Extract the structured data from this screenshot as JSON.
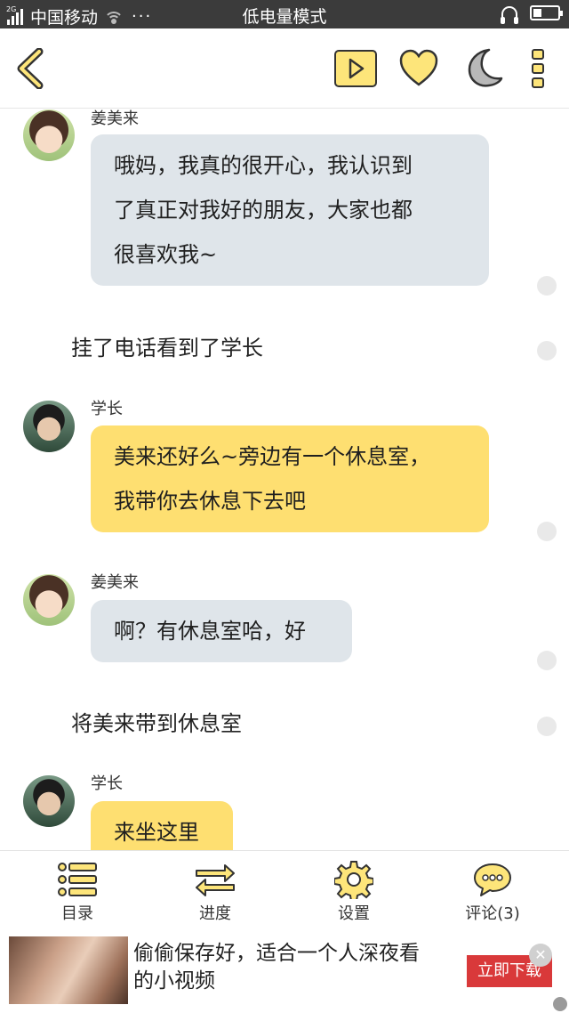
{
  "status_bar": {
    "network_tag": "2G",
    "carrier": "中国移动",
    "more_indicator": "···",
    "mode": "低电量模式",
    "battery_level": 0.35
  },
  "toolbar": {
    "icons": [
      "back-icon",
      "play-icon",
      "heart-icon",
      "moon-icon",
      "more-vertical-icon"
    ],
    "accent": "#fde57a"
  },
  "chat": {
    "messages": [
      {
        "speaker": "姜美来",
        "text_lines": [
          "哦妈，我真的很开心，我认识到",
          "了真正对我好的朋友，大家也都",
          "很喜欢我~"
        ]
      },
      {
        "narration": "挂了电话看到了学长"
      },
      {
        "speaker": "学长",
        "text_lines": [
          "美来还好么~旁边有一个休息室，",
          "我带你去休息下去吧"
        ]
      },
      {
        "speaker": "姜美来",
        "text_lines": [
          "啊？有休息室哈，好"
        ]
      },
      {
        "narration": "将美来带到休息室"
      },
      {
        "speaker": "学长",
        "text_lines": [
          "来坐这里"
        ]
      }
    ],
    "colors": {
      "other_bubble": "#dfe5ea",
      "senior_bubble": "#fedf71"
    }
  },
  "bottom_nav": {
    "items": [
      {
        "label": "目录",
        "icon": "list-icon"
      },
      {
        "label": "进度",
        "icon": "arrows-icon"
      },
      {
        "label": "设置",
        "icon": "gear-icon"
      },
      {
        "label": "评论(3)",
        "icon": "comment-icon"
      }
    ]
  },
  "ad": {
    "text_line1": "偷偷保存好，适合一个人深夜看",
    "text_line2": "的小视频",
    "button": "立即下载",
    "close": "✕",
    "button_color": "#d9393a"
  }
}
